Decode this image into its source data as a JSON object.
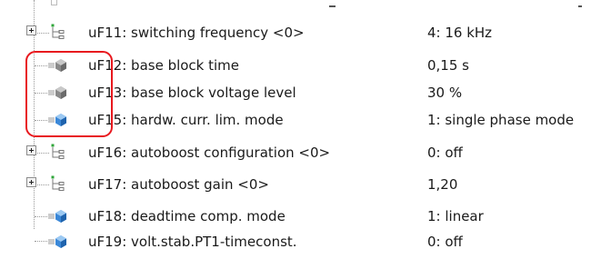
{
  "parameters": [
    {
      "label": "uF11: switching frequency <0>",
      "value": "4: 16 kHz",
      "icon": "group-icon",
      "expandable": true
    },
    {
      "label": "uF12: base block time",
      "value": "0,15 s",
      "icon": "gray-cube-icon",
      "expandable": false
    },
    {
      "label": "uF13: base block voltage level",
      "value": "30 %",
      "icon": "gray-cube-icon",
      "expandable": false
    },
    {
      "label": "uF15: hardw. curr. lim. mode",
      "value": "1: single phase mode",
      "icon": "blue-cube-icon",
      "expandable": false
    },
    {
      "label": "uF16: autoboost configuration <0>",
      "value": "0: off",
      "icon": "group-icon",
      "expandable": true
    },
    {
      "label": "uF17: autoboost gain <0>",
      "value": "1,20",
      "icon": "group-icon",
      "expandable": true
    },
    {
      "label": "uF18: deadtime comp. mode",
      "value": "1: linear",
      "icon": "blue-cube-icon",
      "expandable": false
    },
    {
      "label": "uF19: volt.stab.PT1-timeconst.",
      "value": "0: off",
      "icon": "blue-cube-icon",
      "expandable": false
    }
  ],
  "colors": {
    "highlight": "#e8181e",
    "gray_cube": "#8a8a8a",
    "blue_cube": "#3b88d8",
    "group_node": "#2fa63a"
  }
}
